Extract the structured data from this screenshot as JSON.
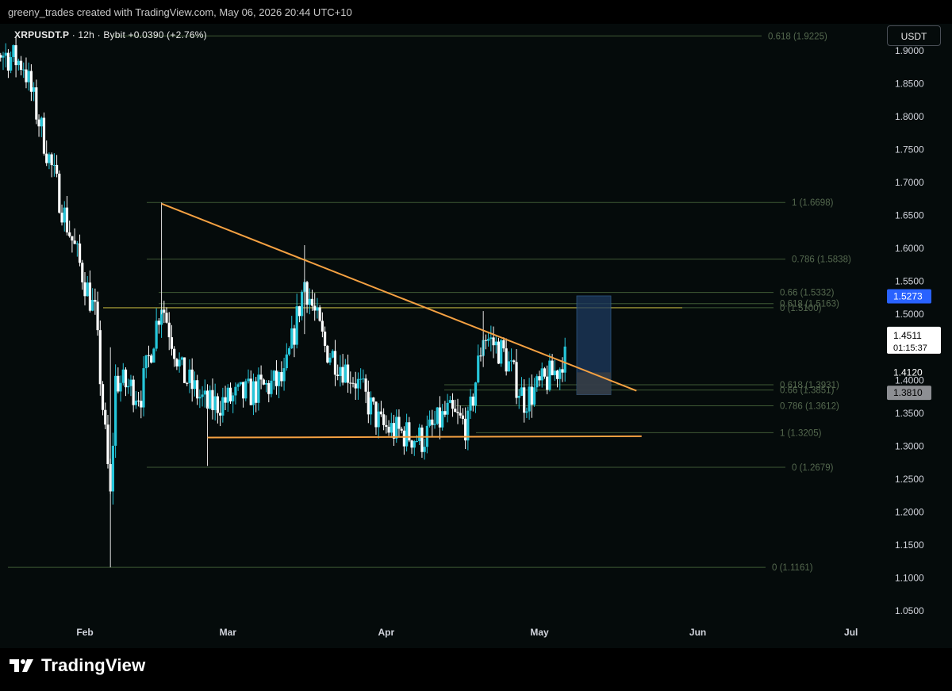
{
  "header": {
    "credit": "greeny_trades created with TradingView.com, May 06, 2026 20:44 UTC+10"
  },
  "legend": {
    "symbol": "XRPUSDT.P",
    "details": "· 12h · Bybit  +0.0390 (+2.76%)"
  },
  "currency_button": "USDT",
  "footer": {
    "brand": "TradingView"
  },
  "colors": {
    "up_candle": "#26c6da",
    "down_candle": "#ffffff",
    "trendline": "#f5a142",
    "fib_line": "#3f5a35",
    "fib_label": "#55694f",
    "yellow_line": "#b5a93a",
    "target_box": "#1e3a5f",
    "current_price": "#ffffff",
    "blue_tag": "#2962ff"
  },
  "chart_data": {
    "type": "candlestick",
    "symbol": "XRPUSDT.P",
    "interval": "12h",
    "exchange": "Bybit",
    "ylim": [
      1.02,
      1.965
    ],
    "y_ticks": [
      "1.9000",
      "1.8500",
      "1.8000",
      "1.7500",
      "1.7000",
      "1.6500",
      "1.6000",
      "1.5500",
      "1.5000",
      "1.4500",
      "1.4000",
      "1.3500",
      "1.3000",
      "1.2500",
      "1.2000",
      "1.1500",
      "1.1000",
      "1.0500"
    ],
    "x_ticks": [
      {
        "label": "Feb",
        "date": "2026-02-01"
      },
      {
        "label": "Mar",
        "date": "2026-03-01"
      },
      {
        "label": "Apr",
        "date": "2026-04-01"
      },
      {
        "label": "May",
        "date": "2026-05-01"
      },
      {
        "label": "Jun",
        "date": "2026-06-01"
      },
      {
        "label": "Jul",
        "date": "2026-07-01"
      }
    ],
    "key_points": [
      {
        "date": "2026-01-10",
        "close": 1.92
      },
      {
        "date": "2026-01-20",
        "close": 1.88
      },
      {
        "date": "2026-01-28",
        "close": 1.65
      },
      {
        "date": "2026-02-03",
        "close": 1.5
      },
      {
        "date": "2026-02-06",
        "close": 1.22
      },
      {
        "date": "2026-02-07",
        "close": 1.4
      },
      {
        "date": "2026-02-12",
        "close": 1.38
      },
      {
        "date": "2026-02-16",
        "close": 1.52
      },
      {
        "date": "2026-02-20",
        "close": 1.41
      },
      {
        "date": "2026-02-25",
        "close": 1.36
      },
      {
        "date": "2026-03-05",
        "close": 1.38
      },
      {
        "date": "2026-03-12",
        "close": 1.4
      },
      {
        "date": "2026-03-16",
        "close": 1.55
      },
      {
        "date": "2026-03-20",
        "close": 1.45
      },
      {
        "date": "2026-03-26",
        "close": 1.4
      },
      {
        "date": "2026-03-31",
        "close": 1.33
      },
      {
        "date": "2026-04-08",
        "close": 1.31
      },
      {
        "date": "2026-04-13",
        "close": 1.35
      },
      {
        "date": "2026-04-17",
        "close": 1.33
      },
      {
        "date": "2026-04-20",
        "close": 1.47
      },
      {
        "date": "2026-04-24",
        "close": 1.44
      },
      {
        "date": "2026-04-28",
        "close": 1.37
      },
      {
        "date": "2026-05-01",
        "close": 1.39
      },
      {
        "date": "2026-05-05",
        "close": 1.42
      },
      {
        "date": "2026-05-06",
        "close": 1.4511
      }
    ],
    "fib_levels": [
      {
        "label": "0.618 (1.9225)",
        "price": 1.9225
      },
      {
        "label": "1 (1.6698)",
        "price": 1.6698
      },
      {
        "label": "0.786 (1.5838)",
        "price": 1.5838
      },
      {
        "label": "0.66 (1.5332)",
        "price": 1.5332
      },
      {
        "label": "0.618 (1.5163)",
        "price": 1.5163
      },
      {
        "label": "0 (1.5100)",
        "price": 1.51
      },
      {
        "label": "0.618 (1.3931)",
        "price": 1.3931
      },
      {
        "label": "0.66 (1.3851)",
        "price": 1.3851
      },
      {
        "label": "0.786 (1.3612)",
        "price": 1.3612
      },
      {
        "label": "1 (1.3205)",
        "price": 1.3205
      },
      {
        "label": "0 (1.2679)",
        "price": 1.2679
      },
      {
        "label": "0 (1.1161)",
        "price": 1.1161
      }
    ],
    "trendlines": [
      {
        "name": "descending resistance",
        "from": {
          "date": "2026-02-16",
          "price": 1.668
        },
        "to": {
          "date": "2026-05-20",
          "price": 1.384
        }
      },
      {
        "name": "horizontal support",
        "from": {
          "date": "2026-02-25",
          "price": 1.313
        },
        "to": {
          "date": "2026-05-21",
          "price": 1.315
        }
      }
    ],
    "target_box": {
      "from_date": "2026-05-09",
      "to_date": "2026-05-15",
      "top": 1.528,
      "bottom": 1.378
    },
    "price_tags": [
      {
        "label": "1.5273",
        "price": 1.5273,
        "style": "blue"
      },
      {
        "label": "1.4511",
        "sub": "01:15:37",
        "price": 1.4511,
        "style": "current"
      },
      {
        "label": "1.4120",
        "price": 1.412,
        "style": "plain"
      },
      {
        "label": "1.3810",
        "price": 1.381,
        "style": "gray"
      }
    ],
    "last_price": 1.4511,
    "countdown": "01:15:37",
    "change": "+0.0390 (+2.76%)"
  }
}
